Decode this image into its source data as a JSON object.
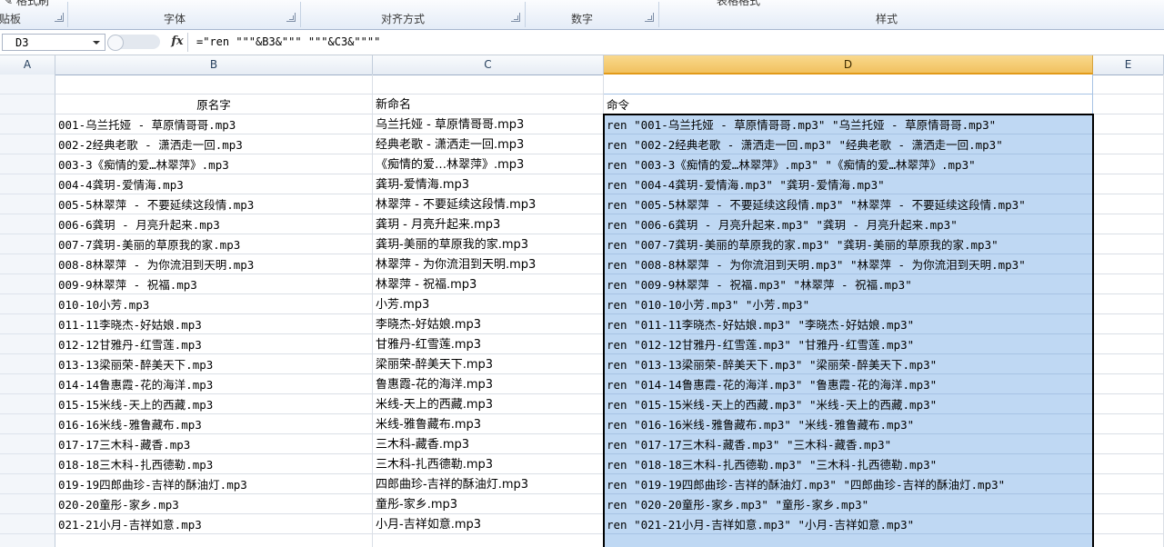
{
  "ribbon": {
    "top_left_fragment": "✎ 格式刷",
    "top_center_fragment": "表格格式",
    "groups": [
      {
        "label": "贴板"
      },
      {
        "label": "字体"
      },
      {
        "label": "对齐方式"
      },
      {
        "label": "数字"
      },
      {
        "label": "样式"
      }
    ]
  },
  "formula_bar": {
    "name_box": "D3",
    "fx": "fx",
    "formula": "=\"ren \"\"\"&B3&\"\"\" \"\"\"&C3&\"\"\"\""
  },
  "columns": [
    "A",
    "B",
    "C",
    "D",
    "E"
  ],
  "selected_column": "D",
  "header_row": {
    "b": "原名字",
    "c": "新命名",
    "d": "命令"
  },
  "rows": [
    {
      "b": "001-乌兰托娅 - 草原情哥哥.mp3",
      "c": "乌兰托娅 - 草原情哥哥.mp3",
      "d": "ren \"001-乌兰托娅 - 草原情哥哥.mp3\" \"乌兰托娅 - 草原情哥哥.mp3\""
    },
    {
      "b": "002-2经典老歌 - 潇洒走一回.mp3",
      "c": "经典老歌 - 潇洒走一回.mp3",
      "d": "ren \"002-2经典老歌 - 潇洒走一回.mp3\" \"经典老歌 - 潇洒走一回.mp3\""
    },
    {
      "b": "003-3《痴情的爱…林翠萍》.mp3",
      "c": "《痴情的爱…林翠萍》.mp3",
      "d": "ren \"003-3《痴情的爱…林翠萍》.mp3\" \"《痴情的爱…林翠萍》.mp3\""
    },
    {
      "b": "004-4龚玥-爱情海.mp3",
      "c": "龚玥-爱情海.mp3",
      "d": "ren \"004-4龚玥-爱情海.mp3\" \"龚玥-爱情海.mp3\""
    },
    {
      "b": "005-5林翠萍 - 不要延续这段情.mp3",
      "c": "林翠萍 - 不要延续这段情.mp3",
      "d": "ren \"005-5林翠萍 - 不要延续这段情.mp3\" \"林翠萍 - 不要延续这段情.mp3\""
    },
    {
      "b": "006-6龚玥 - 月亮升起来.mp3",
      "c": "龚玥 - 月亮升起来.mp3",
      "d": "ren \"006-6龚玥 - 月亮升起来.mp3\" \"龚玥 - 月亮升起来.mp3\""
    },
    {
      "b": "007-7龚玥-美丽的草原我的家.mp3",
      "c": "龚玥-美丽的草原我的家.mp3",
      "d": "ren \"007-7龚玥-美丽的草原我的家.mp3\" \"龚玥-美丽的草原我的家.mp3\""
    },
    {
      "b": "008-8林翠萍 - 为你流泪到天明.mp3",
      "c": "林翠萍 - 为你流泪到天明.mp3",
      "d": "ren \"008-8林翠萍 - 为你流泪到天明.mp3\" \"林翠萍 - 为你流泪到天明.mp3\""
    },
    {
      "b": "009-9林翠萍 - 祝福.mp3",
      "c": "林翠萍 - 祝福.mp3",
      "d": "ren \"009-9林翠萍 - 祝福.mp3\" \"林翠萍 - 祝福.mp3\""
    },
    {
      "b": "010-10小芳.mp3",
      "c": "小芳.mp3",
      "d": "ren \"010-10小芳.mp3\" \"小芳.mp3\""
    },
    {
      "b": "011-11李晓杰-好姑娘.mp3",
      "c": "李晓杰-好姑娘.mp3",
      "d": "ren \"011-11李晓杰-好姑娘.mp3\" \"李晓杰-好姑娘.mp3\""
    },
    {
      "b": "012-12甘雅丹-红雪莲.mp3",
      "c": "甘雅丹-红雪莲.mp3",
      "d": "ren \"012-12甘雅丹-红雪莲.mp3\" \"甘雅丹-红雪莲.mp3\""
    },
    {
      "b": "013-13梁丽荣-醉美天下.mp3",
      "c": "梁丽荣-醉美天下.mp3",
      "d": "ren \"013-13梁丽荣-醉美天下.mp3\" \"梁丽荣-醉美天下.mp3\""
    },
    {
      "b": "014-14鲁惠霞-花的海洋.mp3",
      "c": "鲁惠霞-花的海洋.mp3",
      "d": "ren \"014-14鲁惠霞-花的海洋.mp3\" \"鲁惠霞-花的海洋.mp3\""
    },
    {
      "b": "015-15米线-天上的西藏.mp3",
      "c": "米线-天上的西藏.mp3",
      "d": "ren \"015-15米线-天上的西藏.mp3\" \"米线-天上的西藏.mp3\""
    },
    {
      "b": "016-16米线-雅鲁藏布.mp3",
      "c": "米线-雅鲁藏布.mp3",
      "d": "ren \"016-16米线-雅鲁藏布.mp3\" \"米线-雅鲁藏布.mp3\""
    },
    {
      "b": "017-17三木科-藏香.mp3",
      "c": "三木科-藏香.mp3",
      "d": "ren \"017-17三木科-藏香.mp3\" \"三木科-藏香.mp3\""
    },
    {
      "b": "018-18三木科-扎西德勒.mp3",
      "c": "三木科-扎西德勒.mp3",
      "d": "ren \"018-18三木科-扎西德勒.mp3\" \"三木科-扎西德勒.mp3\""
    },
    {
      "b": "019-19四郎曲珍-吉祥的酥油灯.mp3",
      "c": "四郎曲珍-吉祥的酥油灯.mp3",
      "d": "ren \"019-19四郎曲珍-吉祥的酥油灯.mp3\" \"四郎曲珍-吉祥的酥油灯.mp3\""
    },
    {
      "b": "020-20童彤-家乡.mp3",
      "c": "童彤-家乡.mp3",
      "d": "ren \"020-20童彤-家乡.mp3\" \"童彤-家乡.mp3\""
    },
    {
      "b": "021-21小月-吉祥如意.mp3",
      "c": "小月-吉祥如意.mp3",
      "d": "ren \"021-21小月-吉祥如意.mp3\" \"小月-吉祥如意.mp3\""
    }
  ],
  "colors": {
    "selection_fill": "#bfd8f3",
    "selected_header": "#f1c15f"
  }
}
